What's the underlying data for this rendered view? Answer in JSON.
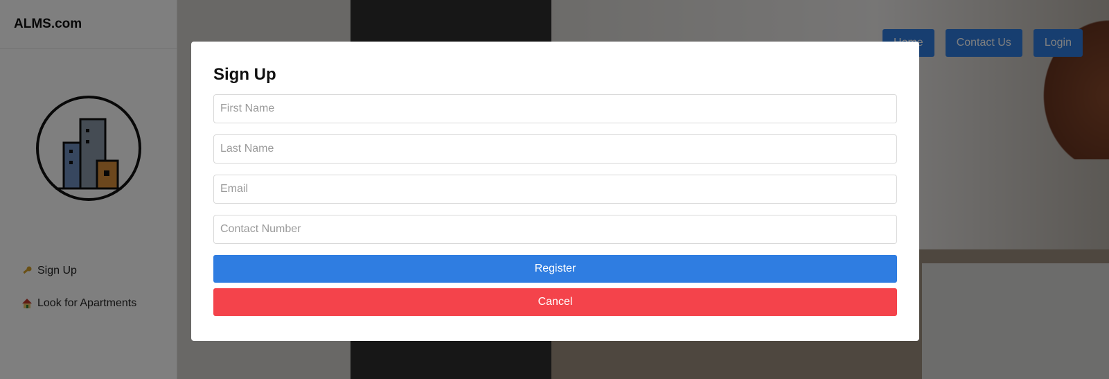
{
  "brand": {
    "name": "ALMS.com"
  },
  "sidebar": {
    "items": [
      {
        "label": "Sign Up",
        "icon": "key-icon"
      },
      {
        "label": "Look for Apartments",
        "icon": "house-icon"
      }
    ]
  },
  "topnav": {
    "home": "Home",
    "contact": "Contact Us",
    "login": "Login"
  },
  "modal": {
    "title": "Sign Up",
    "first_name_placeholder": "First Name",
    "last_name_placeholder": "Last Name",
    "email_placeholder": "Email",
    "contact_placeholder": "Contact Number",
    "register_label": "Register",
    "cancel_label": "Cancel"
  },
  "colors": {
    "primary": "#2f7de1",
    "danger": "#f4434b",
    "overlay": "rgba(0,0,0,0.5)"
  }
}
